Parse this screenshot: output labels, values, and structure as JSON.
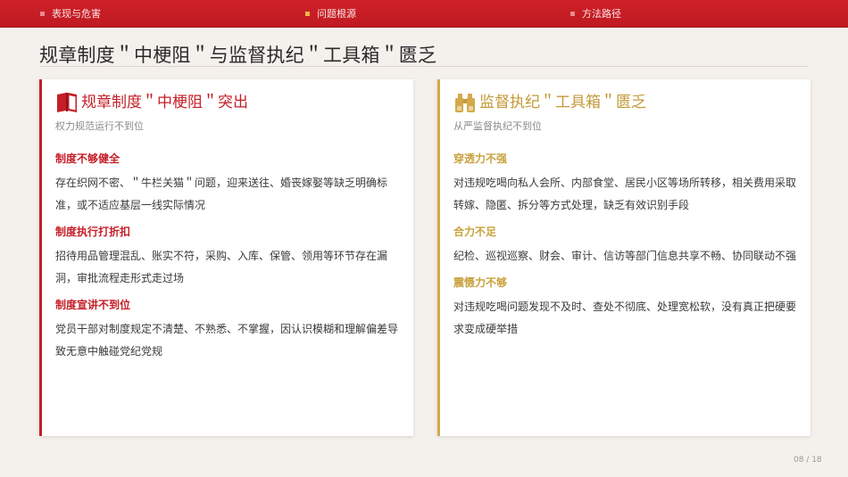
{
  "nav": {
    "items": [
      {
        "label": "表现与危害"
      },
      {
        "label": "问题根源"
      },
      {
        "label": "方法路径"
      }
    ]
  },
  "page_title": "规章制度＂中梗阻＂与监督执纪＂工具箱＂匮乏",
  "cards": [
    {
      "icon": "book-icon",
      "title": "规章制度＂中梗阻＂突出",
      "subtitle": "权力规范运行不到位",
      "accent": "#c41e27",
      "sections": [
        {
          "heading": "制度不够健全",
          "body": "存在织网不密、＂牛栏关猫＂问题，迎来送往、婚丧嫁娶等缺乏明确标准，或不适应基层一线实际情况"
        },
        {
          "heading": "制度执行打折扣",
          "body": "招待用品管理混乱、账实不符，采购、入库、保管、领用等环节存在漏洞，审批流程走形式走过场"
        },
        {
          "heading": "制度宣讲不到位",
          "body": "党员干部对制度规定不清楚、不熟悉、不掌握，因认识模糊和理解偏差导致无意中触碰党纪党规"
        }
      ]
    },
    {
      "icon": "binoculars-icon",
      "title": "监督执纪＂工具箱＂匮乏",
      "subtitle": "从严监督执纪不到位",
      "accent": "#d4a94a",
      "sections": [
        {
          "heading": "穿透力不强",
          "body": "对违规吃喝向私人会所、内部食堂、居民小区等场所转移，相关费用采取转嫁、隐匿、拆分等方式处理，缺乏有效识别手段"
        },
        {
          "heading": "合力不足",
          "body": "纪检、巡视巡察、财会、审计、信访等部门信息共享不畅、协同联动不强"
        },
        {
          "heading": "震慑力不够",
          "body": "对违规吃喝问题发现不及时、查处不彻底、处理宽松软，没有真正把硬要求变成硬举措"
        }
      ]
    }
  ],
  "page_number": "08 / 18"
}
